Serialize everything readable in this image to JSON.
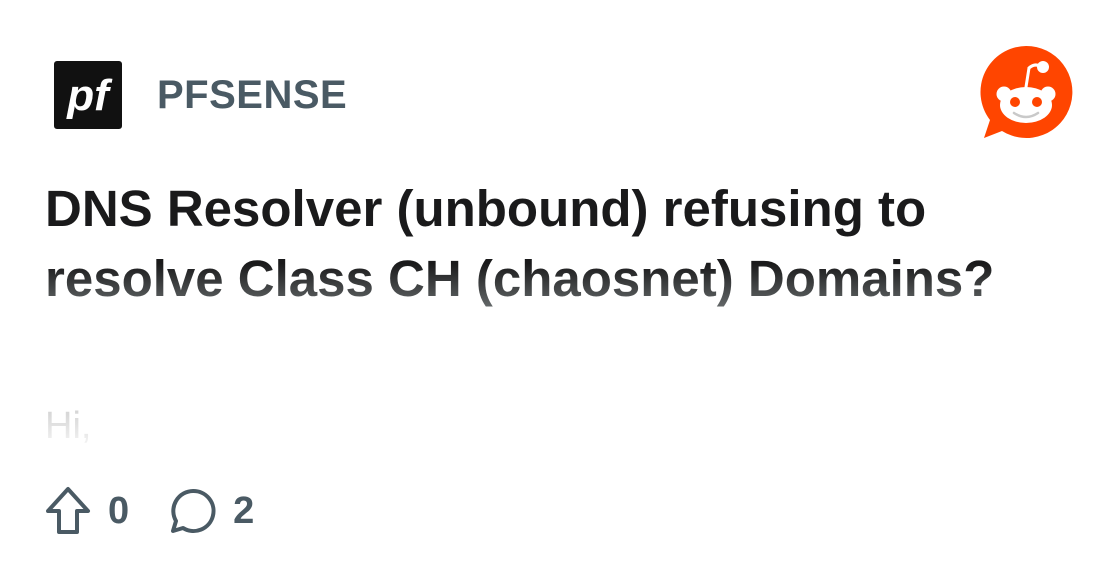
{
  "subreddit": {
    "name": "PFSENSE",
    "logo_text": "pf",
    "logo_icon": "pfsense-logo-icon"
  },
  "brand": {
    "icon": "reddit-snoo-icon",
    "color": "#ff4500"
  },
  "post": {
    "title": "DNS Resolver (unbound) refusing to resolve Class CH (chaosnet) Domains?",
    "body_preview": "Hi,",
    "upvotes": "0",
    "comments": "2"
  },
  "icons": {
    "upvote": "upvote-arrow-icon",
    "comment": "comment-bubble-icon"
  },
  "colors": {
    "title_text": "#1a1a1b",
    "meta_text": "#4a5a64",
    "reddit_orange": "#ff4500"
  }
}
